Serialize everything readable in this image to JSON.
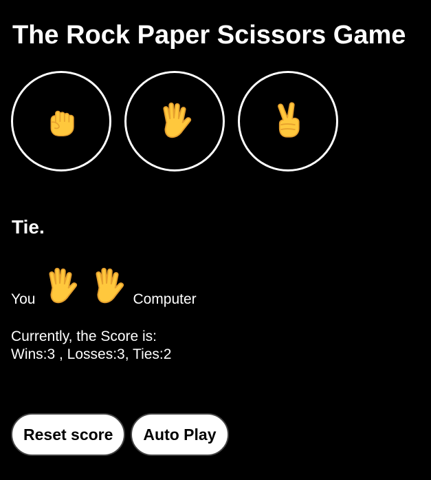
{
  "header": {
    "title": "The Rock Paper Scissors Game"
  },
  "moves": [
    {
      "name": "rock",
      "icon": "fist-icon"
    },
    {
      "name": "paper",
      "icon": "raised-hand-icon"
    },
    {
      "name": "scissors",
      "icon": "victory-hand-icon"
    }
  ],
  "result": {
    "text": "Tie."
  },
  "played": {
    "you_label": "You",
    "player_move_icon": "raised-hand-icon",
    "computer_move_icon": "raised-hand-icon",
    "computer_label": "Computer"
  },
  "score": {
    "heading": "Currently, the Score is:",
    "summary": "Wins:3 , Losses:3, Ties:2"
  },
  "controls": {
    "reset_label": "Reset score",
    "autoplay_label": "Auto Play"
  },
  "colors": {
    "background": "#000000",
    "text": "#ffffff",
    "button_bg": "#ffffff",
    "hand_fill": "#FFC83D",
    "hand_outline": "#E6A02E"
  }
}
